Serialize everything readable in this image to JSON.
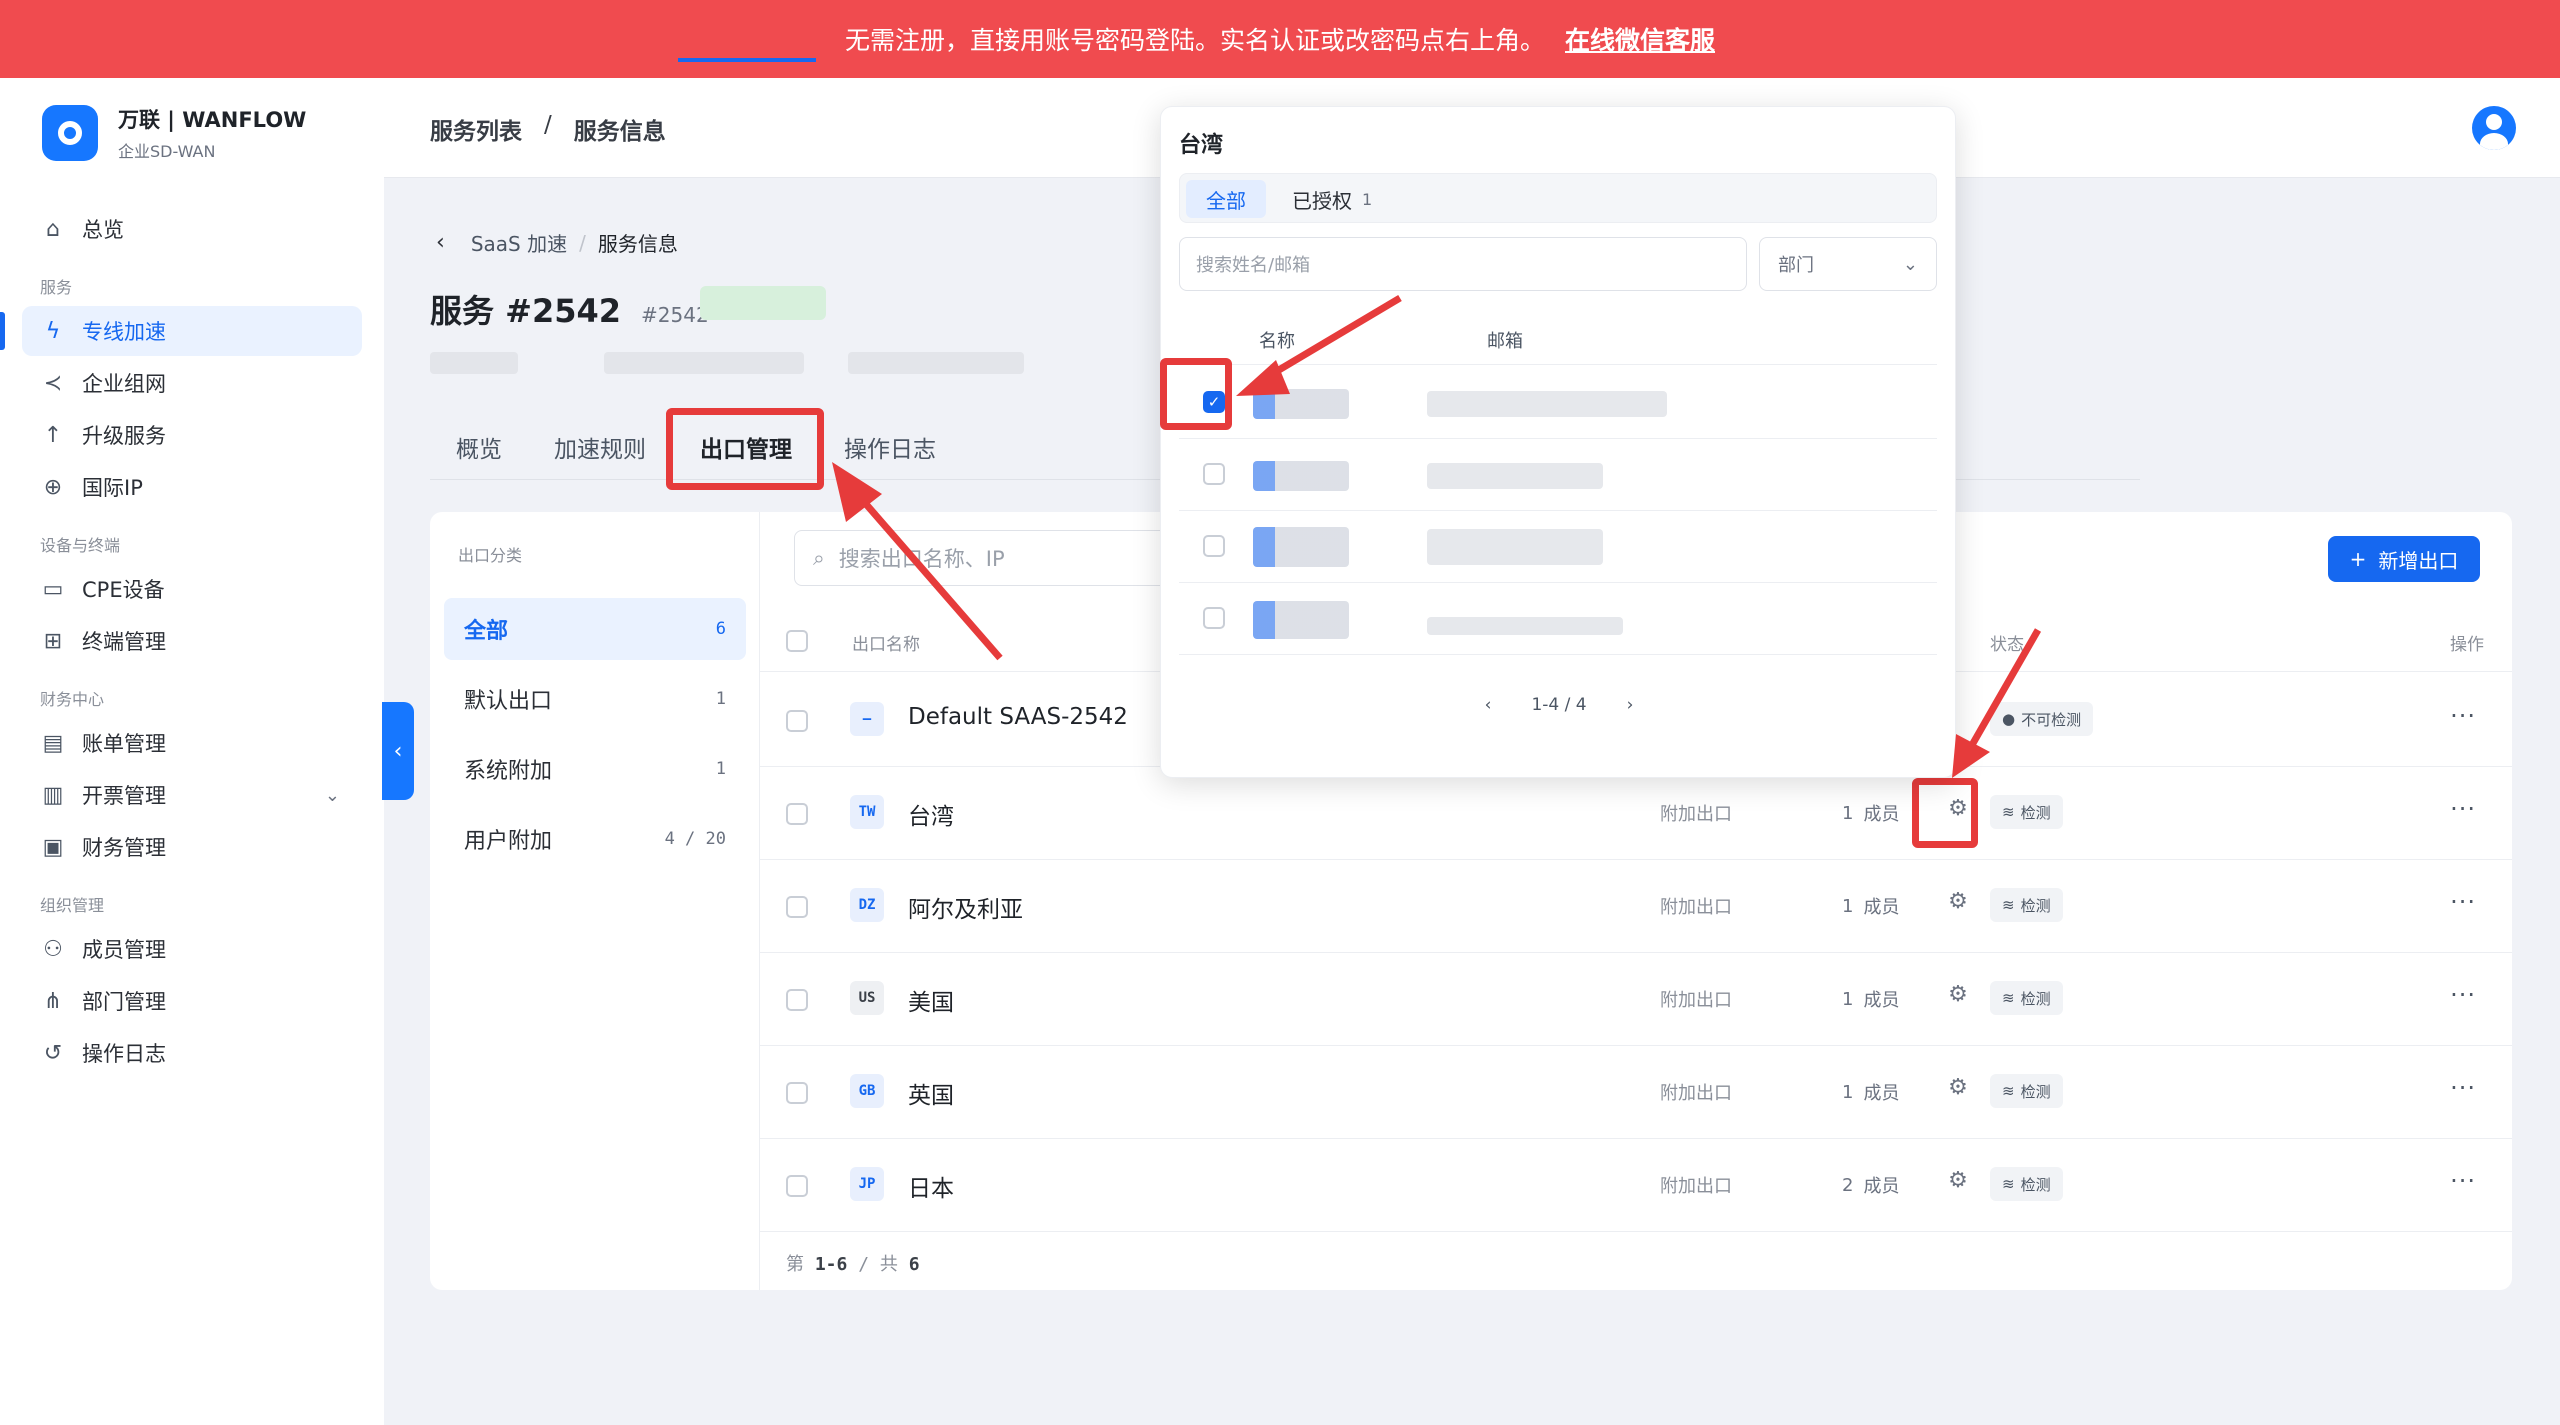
{
  "banner": {
    "message": "无需注册，直接用账号密码登陆。实名认证或改密码点右上角。",
    "link": "在线微信客服"
  },
  "brand": {
    "title": "万联 | WANFLOW",
    "subtitle": "企业SD-WAN"
  },
  "sidebar": {
    "overview": "总览",
    "groups": [
      {
        "title": "服务",
        "items": [
          {
            "label": "专线加速",
            "icon": "lightning-icon",
            "active": true
          },
          {
            "label": "企业组网",
            "icon": "share-icon"
          },
          {
            "label": "升级服务",
            "icon": "arrow-up-icon"
          },
          {
            "label": "国际IP",
            "icon": "globe-icon"
          }
        ]
      },
      {
        "title": "设备与终端",
        "items": [
          {
            "label": "CPE设备",
            "icon": "monitor-icon"
          },
          {
            "label": "终端管理",
            "icon": "grid-icon"
          }
        ]
      },
      {
        "title": "财务中心",
        "items": [
          {
            "label": "账单管理",
            "icon": "bill-icon"
          },
          {
            "label": "开票管理",
            "icon": "invoice-icon"
          },
          {
            "label": "财务管理",
            "icon": "wallet-icon"
          }
        ]
      },
      {
        "title": "组织管理",
        "items": [
          {
            "label": "成员管理",
            "icon": "users-icon"
          },
          {
            "label": "部门管理",
            "icon": "org-icon"
          },
          {
            "label": "操作日志",
            "icon": "history-icon"
          }
        ]
      }
    ]
  },
  "topbar": {
    "crumb1": "服务列表",
    "sep": "/",
    "crumb2": "服务信息"
  },
  "sub_breadcrumb": {
    "parent": "SaaS 加速",
    "sep": "/",
    "current": "服务信息"
  },
  "page": {
    "title": "服务 #2542",
    "id": "#2542"
  },
  "tabs": [
    "概览",
    "加速规则",
    "出口管理",
    "操作日志"
  ],
  "categories": {
    "title": "出口分类",
    "items": [
      {
        "label": "全部",
        "count": "6"
      },
      {
        "label": "默认出口",
        "count": "1"
      },
      {
        "label": "系统附加",
        "count": "1"
      },
      {
        "label": "用户附加",
        "count": "4 / 20"
      }
    ]
  },
  "search": {
    "placeholder": "搜索出口名称、IP"
  },
  "add_button": "新增出口",
  "table": {
    "headers": {
      "name": "出口名称",
      "status": "状态",
      "action": "操作"
    },
    "member_unit": "成员",
    "rows": [
      {
        "code": "—",
        "name": "Default SAAS-2542",
        "type": "",
        "members": "",
        "status": "不可检测"
      },
      {
        "code": "TW",
        "name": "台湾",
        "type": "附加出口",
        "members": "1",
        "status": "检测"
      },
      {
        "code": "DZ",
        "name": "阿尔及利亚",
        "type": "附加出口",
        "members": "1",
        "status": "检测"
      },
      {
        "code": "US",
        "name": "美国",
        "type": "附加出口",
        "members": "1",
        "status": "检测"
      },
      {
        "code": "GB",
        "name": "英国",
        "type": "附加出口",
        "members": "1",
        "status": "检测"
      },
      {
        "code": "JP",
        "name": "日本",
        "type": "附加出口",
        "members": "2",
        "status": "检测"
      }
    ],
    "footer": {
      "prefix": "第",
      "range": "1-6",
      "sep": "/",
      "total_label": "共",
      "total": "6"
    }
  },
  "popover": {
    "title": "台湾",
    "seg_all": "全部",
    "seg_authorized": "已授权",
    "seg_authorized_count": "1",
    "search_placeholder": "搜索姓名/邮箱",
    "dept_placeholder": "部门",
    "col_name": "名称",
    "col_email": "邮箱",
    "pager": "1-4 / 4"
  },
  "colors": {
    "accent": "#1668f0",
    "banner": "#f04b4f",
    "annotation": "#e63b3b"
  }
}
